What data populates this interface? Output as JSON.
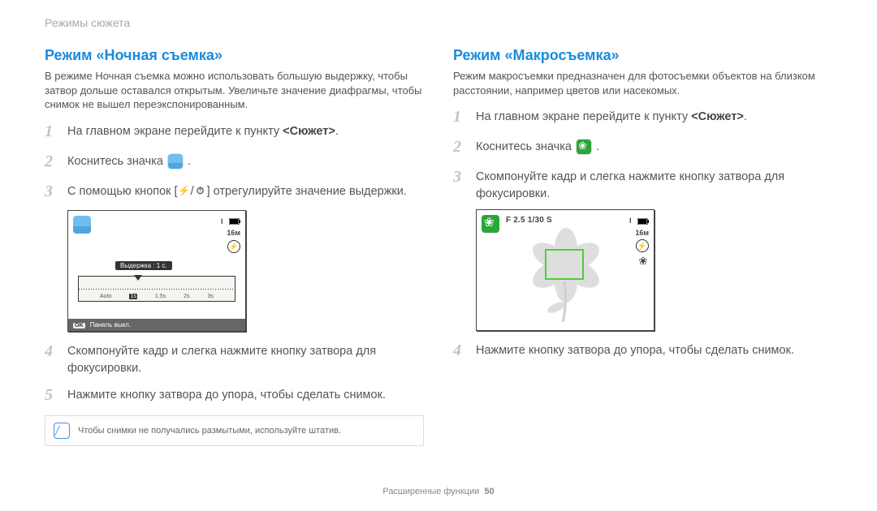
{
  "breadcrumb": "Режимы сюжета",
  "left": {
    "heading": "Режим «Ночная съемка»",
    "blurb": "В режиме Ночная съемка можно использовать большую выдержку, чтобы затвор дольше оставался открытым. Увеличьте значение диафрагмы, чтобы снимок не вышел переэкспонированным.",
    "steps": {
      "s1_pre": "На главном экране перейдите к пункту ",
      "s1_bold": "<Сюжет>",
      "s1_post": ".",
      "s2": "Коснитесь значка",
      "s3_pre": "С помощью кнопок [",
      "s3_mid": "/",
      "s3_post": "] отрегулируйте значение выдержки.",
      "s4": "Скомпонуйте кадр и слегка нажмите кнопку затвора для фокусировки.",
      "s5": "Нажмите кнопку затвора до упора, чтобы сделать снимок."
    },
    "screen": {
      "counter": "I",
      "size": "16м",
      "slider_label": "Выдержка : 1 с.",
      "ticks": [
        "",
        "Auto",
        "1s",
        "1.5s",
        "2s",
        "3s",
        ""
      ],
      "footer_btn": "OK",
      "footer_label": "Панель выкл."
    },
    "note": "Чтобы снимки не получались размытыми, используйте штатив."
  },
  "right": {
    "heading": "Режим «Макросъемка»",
    "blurb": "Режим макросъемки предназначен для фотосъемки объектов на близком расстоянии, например цветов или насекомых.",
    "steps": {
      "s1_pre": "На главном экране перейдите к пункту ",
      "s1_bold": "<Сюжет>",
      "s1_post": ".",
      "s2": "Коснитесь значка",
      "s3": "Скомпонуйте кадр и слегка нажмите кнопку затвора для фокусировки.",
      "s4": "Нажмите кнопку затвора до упора, чтобы сделать снимок."
    },
    "screen": {
      "aperture": "F 2.5 1/30 S",
      "counter": "I",
      "size": "16м"
    }
  },
  "footer": {
    "section": "Расширенные функции",
    "page": "50"
  },
  "nums": {
    "n1": "1",
    "n2": "2",
    "n3": "3",
    "n4": "4",
    "n5": "5"
  }
}
